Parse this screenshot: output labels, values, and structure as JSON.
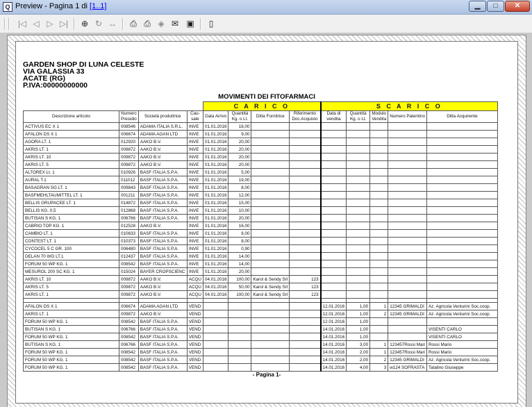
{
  "window": {
    "title_prefix": "Preview - Pagina 1 di ",
    "title_link": "[1..1]",
    "app_icon": "preview-app-icon"
  },
  "toolbar": {
    "icons": [
      "first-page-icon",
      "prev-page-icon",
      "next-page-icon",
      "last-page-icon",
      "zoom-icon",
      "rotate-icon",
      "page-width-icon",
      "print-icon",
      "print-setup-icon",
      "export-icon",
      "email-icon",
      "save-icon",
      "exit-icon"
    ]
  },
  "report": {
    "company": [
      "GARDEN SHOP DI LUNA CELESTE",
      "VIA GALASSIA 33",
      "ACATE (RG)",
      "P.IVA:00000000000"
    ],
    "title": "MOVIMENTI DEI FITOFARMACI",
    "carico_label": "C A R I C O",
    "scarico_label": "S C A R I C O",
    "columns": [
      "Descrizione articolo",
      "Numero Presidio",
      "Società produttrice",
      "Cau-sale",
      "Data Arrivo",
      "Quantità Kg. o Lt.",
      "Ditta Fornitrice",
      "Riferimento Doc.Acquisto",
      "Data di vendita",
      "Quantità Kg. o Lt.",
      "Modulo Vendita",
      "Numero Patentino",
      "Ditta Acquirente"
    ],
    "footer": "- Pagina 1-",
    "rows_carico": [
      [
        "ACTIVUS EC X 1",
        "008546",
        "ADAMA ITALIA S.R.L.",
        "INVE",
        "01.01.2016",
        "16,00",
        "",
        ""
      ],
      [
        "AFALON DS X 1",
        "006674",
        "ADAMA AGAN LTD",
        "INVE",
        "01.01.2016",
        "9,00",
        "",
        ""
      ],
      [
        "AGORA LT. 1",
        "012920",
        "AAKO B.V.",
        "INVE",
        "01.01.2016",
        "20,00",
        "",
        ""
      ],
      [
        "AKRIS LT. 1",
        "009872",
        "AAKO B.V.",
        "INVE",
        "01.01.2016",
        "20,00",
        "",
        ""
      ],
      [
        "AKRIS LT. 10",
        "009872",
        "AAKO B.V.",
        "INVE",
        "01.01.2016",
        "20,00",
        "",
        ""
      ],
      [
        "AKRIS LT. 5",
        "009872",
        "AAKO B.V.",
        "INVE",
        "01.01.2016",
        "20,00",
        "",
        ""
      ],
      [
        "ALTOREX Lt. 1",
        "010926",
        "BASF ITALIA S.P.A.",
        "INVE",
        "01.01.2016",
        "5,00",
        "",
        ""
      ],
      [
        "AURAL T.1",
        "011012",
        "BASF ITALIA S.P.A.",
        "INVE",
        "01.01.2016",
        "19,00",
        "",
        ""
      ],
      [
        "BASAGRAN SG LT. 1",
        "009843",
        "BASF ITALIA S.P.A.",
        "INVE",
        "01.01.2016",
        "8,00",
        "",
        ""
      ],
      [
        "BASFMEHLTAUMITTEL LT. 1",
        "001211",
        "BASF ITALIA S.P.A.",
        "INVE",
        "01.01.2016",
        "12,00",
        "",
        ""
      ],
      [
        "BELLIS GRUPACEE LT. 1",
        "014872",
        "BASF ITALIA S.P.A.",
        "INVE",
        "01.01.2016",
        "15,00",
        "",
        ""
      ],
      [
        "BELLIS KG. 0,5",
        "012868",
        "BASF ITALIA S.P.A.",
        "INVE",
        "01.01.2016",
        "10,00",
        "",
        ""
      ],
      [
        "BUTISAN S KG. 1",
        "006766",
        "BASF ITALIA S.P.A.",
        "INVE",
        "01.01.2016",
        "20,00",
        "",
        ""
      ],
      [
        "CABRIO TOP KG. 1",
        "012528",
        "AAKO B.V.",
        "INVE",
        "01.01.2016",
        "16,00",
        "",
        ""
      ],
      [
        "CAMBIO LT. 1",
        "010633",
        "BASF ITALIA S.P.A.",
        "INVE",
        "01.01.2016",
        "8,00",
        "",
        ""
      ],
      [
        "CONTEST LT. 1",
        "010373",
        "BASF ITALIA S.P.A.",
        "INVE",
        "01.01.2016",
        "8,00",
        "",
        ""
      ],
      [
        "CYCOCEL 5 C GR. 100",
        "006480",
        "BASF ITALIA S.P.A.",
        "INVE",
        "01.01.2016",
        "0,90",
        "",
        ""
      ],
      [
        "DELAN 70 WG LT.1",
        "012437",
        "BASF ITALIA S.P.A.",
        "INVE",
        "01.01.2016",
        "14,00",
        "",
        ""
      ],
      [
        "FORUM 50 WP KG. 1",
        "008542",
        "BASF ITALIA S.P.A.",
        "INVE",
        "01.01.2016",
        "14,00",
        "",
        ""
      ],
      [
        "MESUROL 200 SC KG. 1",
        "015024",
        "BAYER CROPSCIENC",
        "INVE",
        "01.01.2016",
        "20,00",
        "",
        ""
      ],
      [
        "AKRIS LT. 10",
        "009872",
        "AAKO B.V.",
        "ACQU",
        "04.01.2016",
        "100,00",
        "Karol & Sendy Srl",
        "123"
      ],
      [
        "AKRIS LT. 5",
        "009872",
        "AAKO B.V.",
        "ACQU",
        "04.01.2016",
        "50,00",
        "Karol & Sendy Srl",
        "123"
      ],
      [
        "AKRIS LT. 1",
        "009872",
        "AAKO B.V.",
        "ACQU",
        "04.01.2016",
        "100,00",
        "Karol & Sendy Srl",
        "123"
      ]
    ],
    "rows_scarico": [
      [
        "AFALON DS X 1",
        "006674",
        "ADAMA AGAN LTD",
        "VEND",
        "12.01.2016",
        "1,00",
        "1",
        "12345 GRIMALDI",
        "Az. Agricola Venturini Soc.coop."
      ],
      [
        "AKRIS LT. 1",
        "009872",
        "AAKO B.V.",
        "VEND",
        "12.01.2016",
        "1,00",
        "2",
        "12345 GRIMALDI",
        "Az. Agricola Venturini Soc.coop."
      ],
      [
        "FORUM 50 WP KG. 1",
        "008542",
        "BASF ITALIA S.P.A.",
        "VEND",
        "12.01.2016",
        "1,00",
        "",
        "",
        ""
      ],
      [
        "BUTISAN S KG. 1",
        "006766",
        "BASF ITALIA S.P.A.",
        "VEND",
        "14.01.2016",
        "1,00",
        "",
        "",
        "VISENTI CARLO"
      ],
      [
        "FORUM 50 WP KG. 1",
        "008542",
        "BASF ITALIA S.P.A.",
        "VEND",
        "14.01.2016",
        "1,00",
        "",
        "",
        "VISENTI CARLO"
      ],
      [
        "BUTISAN S KG. 1",
        "006766",
        "BASF ITALIA S.P.A.",
        "VEND",
        "14.01.2016",
        "3,00",
        "1",
        "123457Rossi Mari",
        "Rossi Mario"
      ],
      [
        "FORUM 50 WP KG. 1",
        "008542",
        "BASF ITALIA S.P.A.",
        "VEND",
        "14.01.2016",
        "2,00",
        "1",
        "123457Rossi Mari",
        "Rossi Mario"
      ],
      [
        "FORUM 50 WP KG. 1",
        "008542",
        "BASF ITALIA S.P.A.",
        "VEND",
        "14.01.2016",
        "2,00",
        "2",
        "12345 GRIMALDI",
        "Az. Agricola Venturini Soc.coop."
      ],
      [
        "FORUM 50 WP KG. 1",
        "008542",
        "BASF ITALIA S.P.A.",
        "VEND",
        "14.01.2016",
        "4,00",
        "3",
        "w124 SOFRASTA",
        "Tatalino Giuseppe"
      ]
    ]
  }
}
